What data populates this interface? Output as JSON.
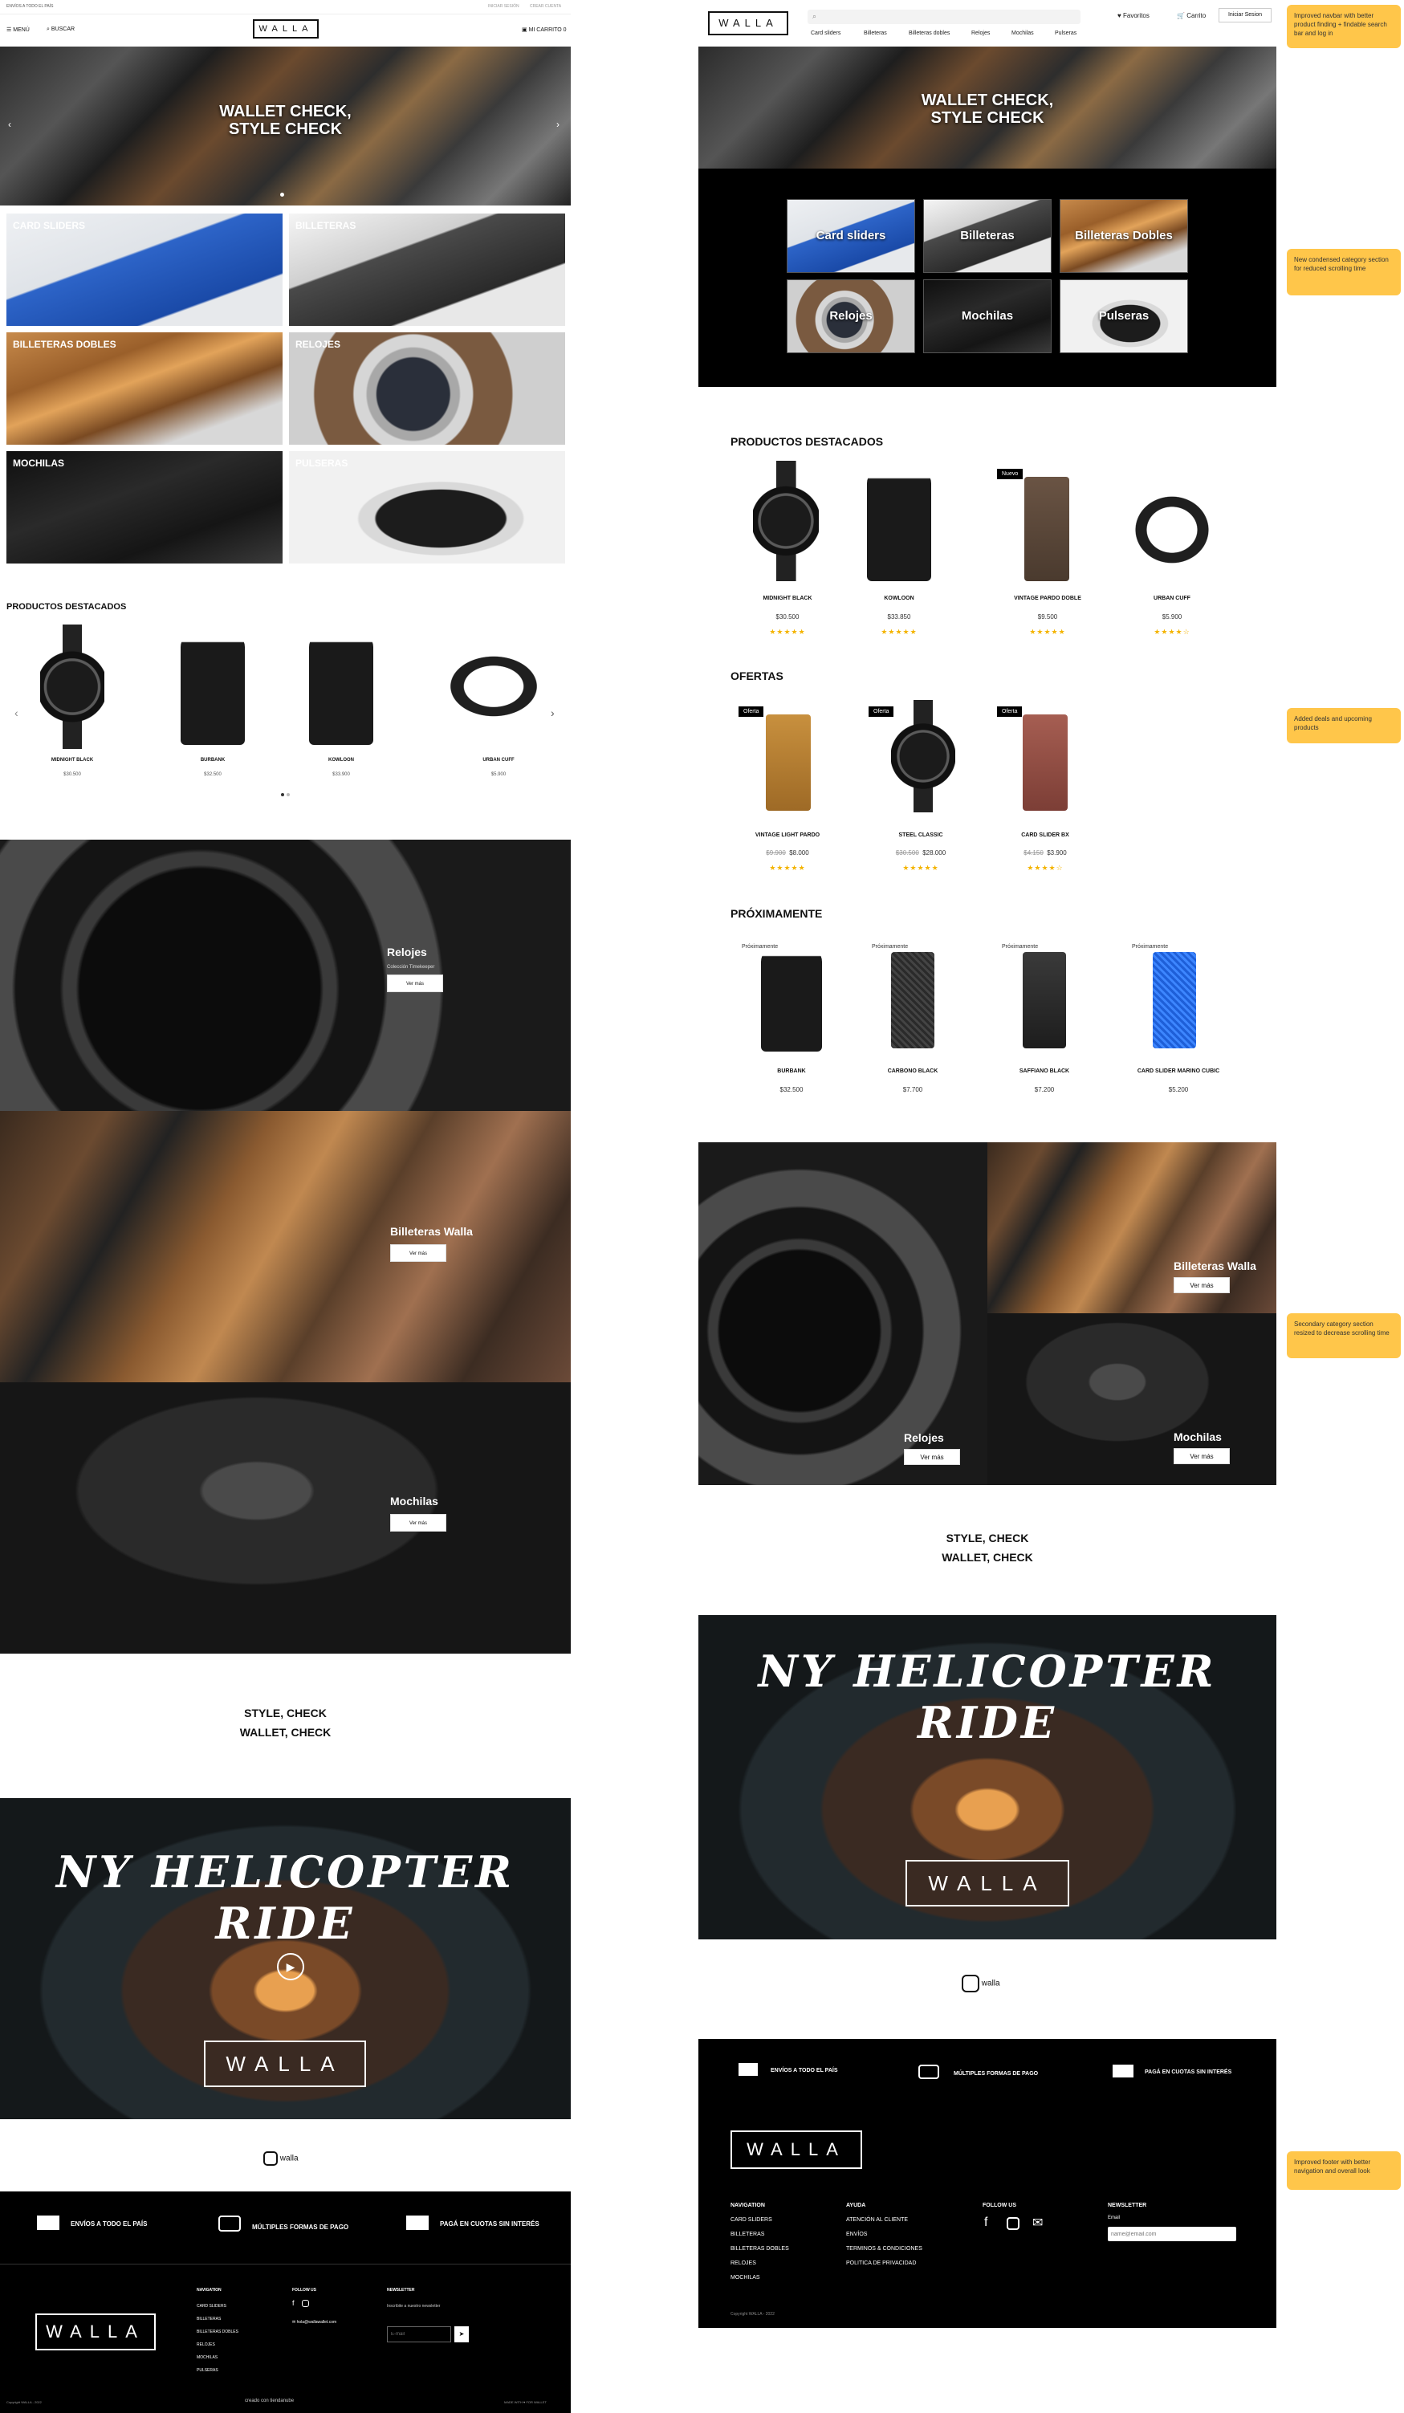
{
  "left": {
    "topbar": {
      "promo": "ENVÍOS A TODO EL PAÍS",
      "link1": "INICIAR SESIÓN",
      "link2": "CREAR CUENTA"
    },
    "header": {
      "menu": "MENÚ",
      "search": "BUSCAR",
      "logo": "WALLA",
      "cart": "MI CARRITO 0"
    },
    "hero": {
      "title1": "WALLET CHECK,",
      "title2": "STYLE CHECK"
    },
    "categories": [
      "CARD SLIDERS",
      "BILLETERAS",
      "BILLETERAS DOBLES",
      "RELOJES",
      "MOCHILAS",
      "PULSERAS"
    ],
    "featured": {
      "heading": "PRODUCTOS DESTACADOS",
      "items": [
        {
          "name": "MIDNIGHT BLACK",
          "price": "$30.500"
        },
        {
          "name": "BURBANK",
          "price": "$32.500"
        },
        {
          "name": "KOWLOON",
          "price": "$33.900"
        },
        {
          "name": "URBAN CUFF",
          "price": "$5.900"
        }
      ]
    },
    "banners": [
      {
        "title": "Relojes",
        "subtitle": "Colección Timekeeper",
        "btn": "Ver más"
      },
      {
        "title": "Billeteras Walla",
        "btn": "Ver más"
      },
      {
        "title": "Mochilas",
        "btn": "Ver más"
      }
    ],
    "tagline1": "STYLE, CHECK",
    "tagline2": "WALLET, CHECK",
    "video": {
      "title": "NY HELICOPTER RIDE",
      "logo": "WALLA"
    },
    "instagram": "walla",
    "benefits": [
      "ENVÍOS A TODO EL PAÍS",
      "MÚLTIPLES FORMAS DE PAGO",
      "PAGÁ EN CUOTAS SIN INTERÉS"
    ],
    "footer": {
      "logo": "WALLA",
      "nav_heading": "NAVIGATION",
      "nav": [
        "CARD SLIDERS",
        "BILLETERAS",
        "BILLETERAS DOBLES",
        "RELOJES",
        "MOCHILAS",
        "PULSERAS"
      ],
      "follow_heading": "FOLLOW US",
      "email": "hola@wallawallet.com",
      "newsletter_heading": "NEWSLETTER",
      "newsletter_text": "Inscribite a nuestro newsletter",
      "newsletter_placeholder": "E-mail",
      "copyright": "Copyright WALLA - 2022",
      "created_by": "creado con",
      "platform": "tiendanube",
      "made": "MADE WITH ♥ FOR WALLET"
    }
  },
  "right": {
    "header": {
      "logo": "WALLA",
      "favs": "Favoritos",
      "cart": "Carrito",
      "login": "Iniciar Sesion",
      "nav": [
        "Card sliders",
        "Billeteras",
        "Billeteras dobles",
        "Relojes",
        "Mochilas",
        "Pulseras"
      ]
    },
    "hero": {
      "title1": "WALLET CHECK,",
      "title2": "STYLE CHECK"
    },
    "categories": [
      "Card sliders",
      "Billeteras",
      "Billeteras Dobles",
      "Relojes",
      "Mochilas",
      "Pulseras"
    ],
    "featured": {
      "heading": "PRODUCTOS DESTACADOS",
      "items": [
        {
          "name": "MIDNIGHT BLACK",
          "price": "$30.500",
          "stars": "★★★★★"
        },
        {
          "name": "KOWLOON",
          "price": "$33.850",
          "stars": "★★★★★"
        },
        {
          "name": "VINTAGE PARDO DOBLE",
          "price": "$9.500",
          "stars": "★★★★★",
          "badge": "Nuevo"
        },
        {
          "name": "URBAN CUFF",
          "price": "$5.900",
          "stars": "★★★★☆"
        }
      ]
    },
    "offers": {
      "heading": "OFERTAS",
      "items": [
        {
          "name": "VINTAGE LIGHT PARDO",
          "old": "$9.900",
          "price": "$8.000",
          "stars": "★★★★★",
          "badge": "Oferta"
        },
        {
          "name": "STEEL CLASSIC",
          "old": "$30.500",
          "price": "$28.000",
          "stars": "★★★★★",
          "badge": "Oferta"
        },
        {
          "name": "CARD SLIDER BX",
          "old": "$4.150",
          "price": "$3.900",
          "stars": "★★★★☆",
          "badge": "Oferta"
        }
      ]
    },
    "upcoming": {
      "heading": "PRÓXIMAMENTE",
      "items": [
        {
          "name": "BURBANK",
          "price": "$32.500",
          "badge": "Próximamente"
        },
        {
          "name": "CARBONO BLACK",
          "price": "$7.700",
          "badge": "Próximamente"
        },
        {
          "name": "SAFFIANO BLACK",
          "price": "$7.200",
          "badge": "Próximamente"
        },
        {
          "name": "CARD SLIDER MARINO CUBIC",
          "price": "$5.200",
          "badge": "Próximamente"
        }
      ]
    },
    "grid": [
      {
        "title": "Billeteras Walla",
        "btn": "Ver más"
      },
      {
        "title": "Relojes",
        "btn": "Ver más"
      },
      {
        "title": "Mochilas",
        "btn": "Ver más"
      }
    ],
    "tagline1": "STYLE, CHECK",
    "tagline2": "WALLET, CHECK",
    "video": {
      "title": "NY HELICOPTER RIDE",
      "logo": "WALLA"
    },
    "instagram": "walla",
    "benefits": [
      "ENVÍOS A TODO EL PAÍS",
      "MÚLTIPLES FORMAS DE PAGO",
      "PAGÁ EN CUOTAS SIN INTERÉS"
    ],
    "footer": {
      "logo": "WALLA",
      "nav_heading": "NAVIGATION",
      "nav": [
        "CARD SLIDERS",
        "BILLETERAS",
        "BILLETERAS DOBLES",
        "RELOJES",
        "MOCHILAS"
      ],
      "help_heading": "AYUDA",
      "help": [
        "ATENCIÓN AL CLIENTE",
        "ENVÍOS",
        "TERMINOS & CONDICIONES",
        "POLITICA DE PRIVACIDAD"
      ],
      "follow_heading": "FOLLOW US",
      "newsletter_heading": "NEWSLETTER",
      "email_label": "Email",
      "email_placeholder": "name@email.com",
      "copyright": "Copyright WALLA - 2022"
    }
  },
  "notes": [
    "Improved navbar with better product finding + findable search bar and log in",
    "New condensed category section for reduced scrolling time",
    "Added deals and upcoming products",
    "Secondary category section resized to decrease scrolling time",
    "Improved footer with better navigation and overall look"
  ]
}
